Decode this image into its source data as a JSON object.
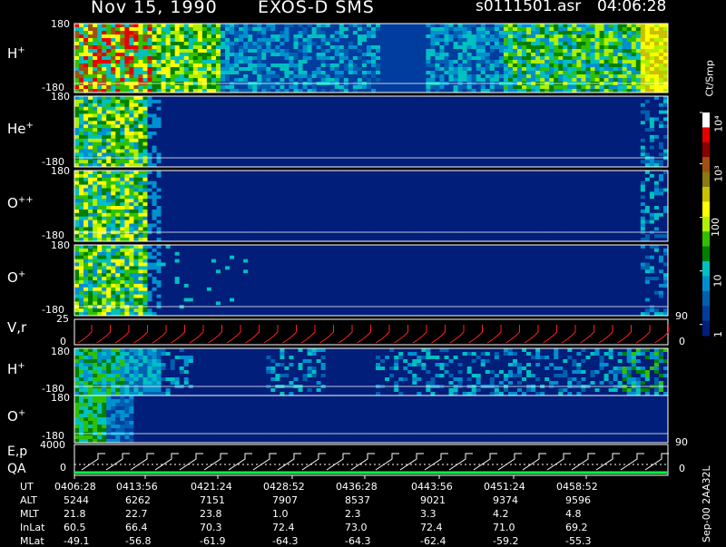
{
  "header": {
    "date": "Nov 15, 1990",
    "instrument": "EXOS-D SMS",
    "file": "s0111501.asr",
    "time": "04:06:28"
  },
  "colorbar": {
    "unit": "Ct/Smp",
    "ticks": [
      "10⁴",
      "10³",
      "100",
      "10",
      "1"
    ],
    "colors": [
      "#ffffff",
      "#e80000",
      "#8a0000",
      "#a05010",
      "#8a7a10",
      "#c8c000",
      "#ffff00",
      "#b0f000",
      "#30c000",
      "#008000",
      "#00c0c0",
      "#0090d0",
      "#0060b0",
      "#003d9e",
      "#001e7a"
    ]
  },
  "panels": [
    {
      "label": "H",
      "sup": "+",
      "ytop": "180",
      "ybot": "-180"
    },
    {
      "label": "He",
      "sup": "+",
      "ytop": "180",
      "ybot": "-180"
    },
    {
      "label": "O",
      "sup": "++",
      "ytop": "180",
      "ybot": "-180"
    },
    {
      "label": "O",
      "sup": "+",
      "ytop": "180",
      "ybot": "-180"
    },
    {
      "label": "V,r",
      "sup": "",
      "ytop": "25",
      "ybot": "0",
      "right": "90",
      "right2": "0"
    },
    {
      "label": "H",
      "sup": "+",
      "ytop": "180",
      "ybot": "-180"
    },
    {
      "label": "O",
      "sup": "+",
      "ytop": "180",
      "ybot": "-180"
    },
    {
      "label": "E,p",
      "label2": "QA",
      "ytop": "4000",
      "ybot": "0",
      "right": "90",
      "right2": "0"
    }
  ],
  "orbit_table": {
    "rows": [
      {
        "name": "UT",
        "values": [
          "0406:28",
          "0413:56",
          "0421:24",
          "0428:52",
          "0436:28",
          "0443:56",
          "0451:24",
          "0458:52"
        ]
      },
      {
        "name": "ALT",
        "values": [
          "5244",
          "6262",
          "7151",
          "7907",
          "8537",
          "9021",
          "9374",
          "9596"
        ]
      },
      {
        "name": "MLT",
        "values": [
          "21.8",
          "22.7",
          "23.8",
          "1.0",
          "2.3",
          "3.3",
          "4.2",
          "4.8"
        ]
      },
      {
        "name": "InLat",
        "values": [
          "60.5",
          "66.4",
          "70.3",
          "72.4",
          "73.0",
          "72.4",
          "71.0",
          "69.2"
        ]
      },
      {
        "name": "MLat",
        "values": [
          "-49.1",
          "-56.8",
          "-61.9",
          "-64.3",
          "-64.3",
          "-62.4",
          "-59.2",
          "-55.3"
        ]
      }
    ],
    "footer": "Sep-00 2AA32L"
  },
  "chart_data": {
    "type": "heatmap",
    "title": "Nov 15, 1990 EXOS-D SMS",
    "x": [
      "0406:28",
      "0413:56",
      "0421:24",
      "0428:52",
      "0436:28",
      "0443:56",
      "0451:24",
      "0458:52"
    ],
    "colorscale": "log counts per sample",
    "colorscale_ticks": [
      1,
      10,
      100,
      1000,
      10000
    ],
    "panels": [
      "H+",
      "He+",
      "O++",
      "O+",
      "V,r",
      "H+",
      "O+",
      "E,p QA"
    ],
    "grid": false
  }
}
